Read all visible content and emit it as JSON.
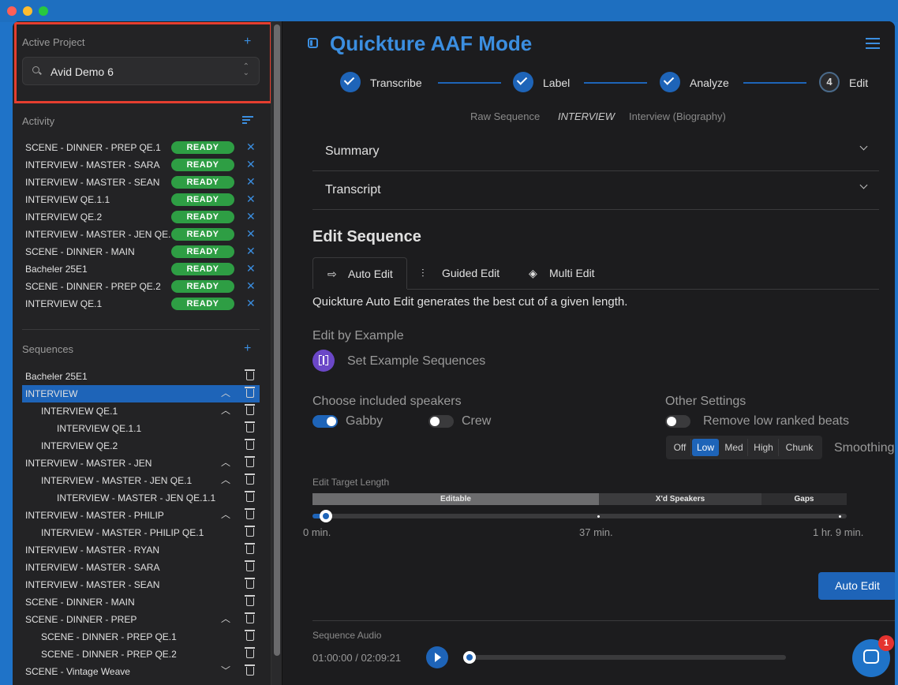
{
  "sidebar": {
    "active_project_title": "Active Project",
    "project_value": "Avid Demo 6",
    "activity_title": "Activity",
    "activity_items": [
      {
        "name": "SCENE - DINNER - PREP QE.1",
        "status": "READY"
      },
      {
        "name": "INTERVIEW - MASTER - SARA",
        "status": "READY"
      },
      {
        "name": "INTERVIEW - MASTER - SEAN",
        "status": "READY"
      },
      {
        "name": "INTERVIEW QE.1.1",
        "status": "READY"
      },
      {
        "name": "INTERVIEW QE.2",
        "status": "READY"
      },
      {
        "name": "INTERVIEW - MASTER - JEN QE.1",
        "status": "READY"
      },
      {
        "name": "SCENE - DINNER - MAIN",
        "status": "READY"
      },
      {
        "name": "Bacheler 25E1",
        "status": "READY"
      },
      {
        "name": "SCENE - DINNER - PREP QE.2",
        "status": "READY"
      },
      {
        "name": "INTERVIEW QE.1",
        "status": "READY"
      }
    ],
    "sequences_title": "Sequences",
    "sequences": [
      {
        "name": "Bacheler 25E1",
        "level": 0,
        "caret": ""
      },
      {
        "name": "INTERVIEW",
        "level": 0,
        "caret": "up",
        "active": true
      },
      {
        "name": "INTERVIEW QE.1",
        "level": 1,
        "caret": "up"
      },
      {
        "name": "INTERVIEW QE.1.1",
        "level": 2,
        "caret": ""
      },
      {
        "name": "INTERVIEW QE.2",
        "level": 1,
        "caret": ""
      },
      {
        "name": "INTERVIEW - MASTER - JEN",
        "level": 0,
        "caret": "up"
      },
      {
        "name": "INTERVIEW - MASTER - JEN QE.1",
        "level": 1,
        "caret": "up"
      },
      {
        "name": "INTERVIEW - MASTER - JEN QE.1.1",
        "level": 2,
        "caret": ""
      },
      {
        "name": "INTERVIEW - MASTER - PHILIP",
        "level": 0,
        "caret": "up"
      },
      {
        "name": "INTERVIEW - MASTER - PHILIP QE.1",
        "level": 1,
        "caret": ""
      },
      {
        "name": "INTERVIEW - MASTER - RYAN",
        "level": 0,
        "caret": ""
      },
      {
        "name": "INTERVIEW - MASTER - SARA",
        "level": 0,
        "caret": ""
      },
      {
        "name": "INTERVIEW - MASTER - SEAN",
        "level": 0,
        "caret": ""
      },
      {
        "name": "SCENE - DINNER - MAIN",
        "level": 0,
        "caret": ""
      },
      {
        "name": "SCENE - DINNER - PREP",
        "level": 0,
        "caret": "up"
      },
      {
        "name": "SCENE - DINNER - PREP QE.1",
        "level": 1,
        "caret": ""
      },
      {
        "name": "SCENE - DINNER - PREP QE.2",
        "level": 1,
        "caret": ""
      },
      {
        "name": "SCENE - Vintage Weave",
        "level": 0,
        "caret": "down"
      }
    ]
  },
  "main": {
    "title": "Quickture AAF Mode",
    "steps": [
      {
        "label": "Transcribe",
        "state": "done"
      },
      {
        "label": "Label",
        "state": "done"
      },
      {
        "label": "Analyze",
        "state": "done"
      },
      {
        "label": "Edit",
        "state": "current",
        "number": "4"
      }
    ],
    "breadcrumb": [
      "Raw Sequence",
      "INTERVIEW",
      "Interview (Biography)"
    ],
    "accordions": [
      "Summary",
      "Transcript"
    ],
    "edit_sequence_title": "Edit Sequence",
    "tabs": [
      "Auto Edit",
      "Guided Edit",
      "Multi Edit"
    ],
    "description": "Quickture Auto Edit generates the best cut of a given length.",
    "edit_by_example": "Edit by Example",
    "set_example": "Set Example Sequences",
    "speakers_title": "Choose included speakers",
    "speakers": [
      {
        "label": "Gabby",
        "on": true
      },
      {
        "label": "Crew",
        "on": false
      }
    ],
    "other_settings_title": "Other Settings",
    "remove_low_ranked": "Remove low ranked beats",
    "smoothing_options": [
      "Off",
      "Low",
      "Med",
      "High",
      "Chunk"
    ],
    "smoothing_selected": "Low",
    "smoothing_label": "Smoothing",
    "target_length_label": "Edit Target Length",
    "segments": [
      "Editable",
      "X'd Speakers",
      "Gaps"
    ],
    "ticks": [
      "0 min.",
      "37 min.",
      "1 hr. 9 min."
    ],
    "target_value_fraction": 0.02,
    "auto_edit_button": "Auto Edit",
    "audio_label": "Sequence Audio",
    "audio_time": "01:00:00 / 02:09:21",
    "audio_progress_fraction": 0.0,
    "chat_badge": "1"
  },
  "colors": {
    "accent": "#3b8ee0",
    "primary_button": "#1e64b8",
    "ready_badge": "#2e9e44",
    "highlight_box": "#e53e2f"
  }
}
